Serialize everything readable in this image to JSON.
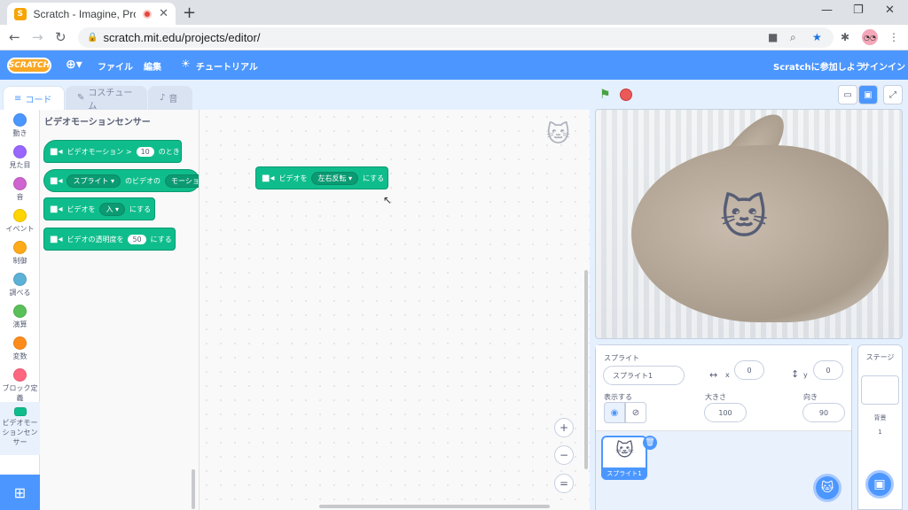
{
  "browser": {
    "tab_title": "Scratch - Imagine, Program, S",
    "favicon": "S",
    "url": "scratch.mit.edu/projects/editor/"
  },
  "menubar": {
    "logo": "SCRATCH",
    "file": "ファイル",
    "edit": "編集",
    "tutorial": "チュートリアル",
    "join": "Scratchに参加しよう",
    "signin": "サインイン"
  },
  "tabs": {
    "code": "コード",
    "costume": "コスチューム",
    "sound": "音"
  },
  "categories": [
    {
      "label": "動き",
      "color": "#4c97ff"
    },
    {
      "label": "見た目",
      "color": "#9966ff"
    },
    {
      "label": "音",
      "color": "#cf63cf"
    },
    {
      "label": "イベント",
      "color": "#ffd500"
    },
    {
      "label": "制御",
      "color": "#ffab19"
    },
    {
      "label": "調べる",
      "color": "#5cb1d6"
    },
    {
      "label": "演算",
      "color": "#59c059"
    },
    {
      "label": "変数",
      "color": "#ff8c1a"
    },
    {
      "label": "ブロック定義",
      "color": "#ff6680"
    },
    {
      "label": "ビデオモーションセンサー",
      "color": "#0fbd8c"
    }
  ],
  "palette": {
    "title": "ビデオモーションセンサー",
    "block1": {
      "text": "ビデオモーション >",
      "value": "10",
      "suffix": "のとき"
    },
    "block2": {
      "dd": "スプライト",
      "mid": "のビデオの",
      "dd2": "モーション"
    },
    "block3": {
      "text": "ビデオを",
      "dd": "入",
      "suffix": "にする"
    },
    "block4": {
      "text": "ビデオの透明度を",
      "value": "50",
      "suffix": "にする"
    }
  },
  "script": {
    "block": {
      "text": "ビデオを",
      "dd": "左右反転",
      "suffix": "にする"
    }
  },
  "sprite_info": {
    "sprite_label": "スプライト",
    "sprite_name": "スプライト1",
    "x_label": "x",
    "x": "0",
    "y_label": "y",
    "y": "0",
    "show_label": "表示する",
    "size_label": "大きさ",
    "size": "100",
    "direction_label": "向き",
    "direction": "90"
  },
  "sprite_list": {
    "item_name": "スプライト1"
  },
  "stage_pane": {
    "title": "ステージ",
    "backdrops_label": "背景",
    "backdrops_count": "1"
  },
  "colors": {
    "scratch_blue": "#4c97ff",
    "video_green": "#0fbd8c"
  }
}
